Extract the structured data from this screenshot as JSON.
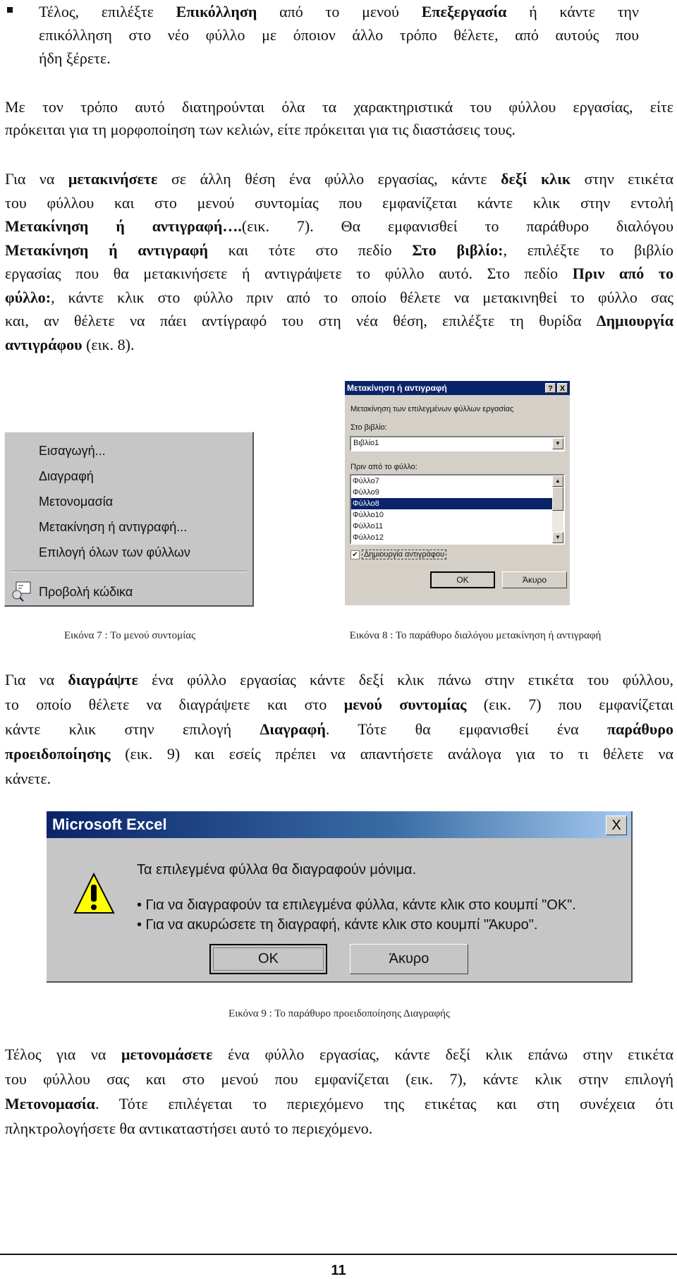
{
  "paragraphs": [
    {
      "id": "bullet-para",
      "lines": [
        [
          {
            "t": "Τέλος, επιλέξτε "
          },
          {
            "t": "Επικόλληση",
            "b": true
          },
          {
            "t": " από το μενού "
          },
          {
            "t": "Επεξεργασία",
            "b": true
          },
          {
            "t": " ή κάντε την"
          }
        ],
        [
          {
            "t": "επικόλληση στο νέο φύλλο με όποιον άλλο τρόπο θέλετε, από αυτούς που"
          }
        ],
        [
          {
            "t": "ήδη ξέρετε."
          }
        ]
      ]
    },
    {
      "id": "para-2",
      "lines": [
        [
          {
            "t": "Με τον τρόπο αυτό διατηρούνται όλα τα χαρακτηριστικά του φύλλου εργασίας, είτε"
          }
        ],
        [
          {
            "t": "πρόκειται για τη μορφοποίηση των κελιών, είτε πρόκειται για τις διαστάσεις τους."
          }
        ]
      ]
    },
    {
      "id": "para-3",
      "lines": [
        [
          {
            "t": "Για να "
          },
          {
            "t": "μετακινήσετε",
            "b": true
          },
          {
            "t": " σε άλλη θέση ένα φύλλο εργασίας, κάντε "
          },
          {
            "t": "δεξί κλικ",
            "b": true
          },
          {
            "t": " στην ετικέτα"
          }
        ],
        [
          {
            "t": "του φύλλου και στο μενού συντομίας που εμφανίζεται κάντε κλικ στην εντολή"
          }
        ],
        [
          {
            "t": "Μετακίνηση ή αντιγραφή….",
            "b": true
          },
          {
            "t": "(εικ. 7). Θα εμφανισθεί το παράθυρο διαλόγου"
          }
        ],
        [
          {
            "t": "Μετακίνηση ή αντιγραφή",
            "b": true
          },
          {
            "t": " και τότε στο πεδίο "
          },
          {
            "t": "Στο βιβλίο:",
            "b": true
          },
          {
            "t": ", επιλέξτε το βιβλίο"
          }
        ],
        [
          {
            "t": "εργασίας που θα μετακινήσετε ή αντιγράψετε το φύλλο αυτό. Στο πεδίο "
          },
          {
            "t": "Πριν από το",
            "b": true
          }
        ],
        [
          {
            "t": "φύλλο:",
            "b": true
          },
          {
            "t": ", κάντε κλικ στο φύλλο πριν από το οποίο θέλετε να μετακινηθεί το φύλλο σας"
          }
        ],
        [
          {
            "t": "και, αν θέλετε να πάει αντίγραφό του στη νέα θέση, επιλέξτε τη θυρίδα "
          },
          {
            "t": "Δημιουργία",
            "b": true
          }
        ],
        [
          {
            "t": "αντιγράφου",
            "b": true
          },
          {
            "t": " (εικ. 8)."
          }
        ]
      ]
    },
    {
      "id": "para-4",
      "lines": [
        [
          {
            "t": "Για να "
          },
          {
            "t": "διαγράψτε",
            "b": true
          },
          {
            "t": " ένα φύλλο εργασίας κάντε δεξί κλικ πάνω στην ετικέτα του φύλλου,"
          }
        ],
        [
          {
            "t": "το οποίο θέλετε να διαγράψετε και στο "
          },
          {
            "t": "μενού συντομίας",
            "b": true
          },
          {
            "t": " (εικ. 7) που εμφανίζεται"
          }
        ],
        [
          {
            "t": "κάντε κλικ στην επιλογή "
          },
          {
            "t": "Διαγραφή",
            "b": true
          },
          {
            "t": ". Τότε θα εμφανισθεί ένα "
          },
          {
            "t": "παράθυρο",
            "b": true
          }
        ],
        [
          {
            "t": "προειδοποίησης",
            "b": true
          },
          {
            "t": " (εικ. 9) και εσείς πρέπει να απαντήσετε ανάλογα για το τι θέλετε να"
          }
        ],
        [
          {
            "t": "κάνετε."
          }
        ]
      ]
    },
    {
      "id": "para-5",
      "lines": [
        [
          {
            "t": "Τέλος για να "
          },
          {
            "t": "μετονομάσετε",
            "b": true
          },
          {
            "t": " ένα φύλλο εργασίας, κάντε δεξί κλικ επάνω στην ετικέτα"
          }
        ],
        [
          {
            "t": "του φύλλου σας και στο μενού που εμφανίζεται (εικ. 7), κάντε κλικ στην επιλογή"
          }
        ],
        [
          {
            "t": "Μετονομασία",
            "b": true
          },
          {
            "t": ". Τότε επιλέγεται το περιεχόμενο της ετικέτας και στη συνέχεια ότι"
          }
        ],
        [
          {
            "t": "πληκτρολογήσετε θα αντικαταστήσει αυτό το περιεχόμενο."
          }
        ]
      ]
    }
  ],
  "context_menu": {
    "items": [
      "Εισαγωγή...",
      "Διαγραφή",
      "Μετονομασία",
      "Μετακίνηση ή αντιγραφή...",
      "Επιλογή όλων των φύλλων"
    ],
    "view_code": "Προβολή κώδικα",
    "view_code_icon": "view-code-icon"
  },
  "move_dialog": {
    "title": "Μετακίνηση ή αντιγραφή",
    "help": "?",
    "close": "X",
    "description": "Μετακίνηση των επιλεγμένων φύλλων εργασίας",
    "book_label": "Στο βιβλίο:",
    "book_value": "Βιβλίο1",
    "before_label": "Πριν από το φύλλο:",
    "sheets": [
      "Φύλλο7",
      "Φύλλο9",
      "Φύλλο8",
      "Φύλλο10",
      "Φύλλο11",
      "Φύλλο12"
    ],
    "selected_sheet": "Φύλλο8",
    "create_copy_label": "Δημιουργία αντιγράφου",
    "create_copy_checked": true,
    "ok": "OK",
    "cancel": "Άκυρο"
  },
  "excel_dialog": {
    "title": "Microsoft Excel",
    "close": "X",
    "message": "Τα επιλεγμένα φύλλα θα διαγραφούν μόνιμα.",
    "bullets": [
      "• Για να διαγραφούν τα επιλεγμένα φύλλα, κάντε κλικ στο κουμπί \"OK\".",
      "• Για να ακυρώσετε τη διαγραφή, κάντε κλικ στο κουμπί \"Άκυρο\"."
    ],
    "ok": "OK",
    "cancel": "Άκυρο",
    "icon": "warning-icon",
    "title_color": "#0a246a"
  },
  "captions": {
    "fig7": "Εικόνα 7 : Το μενού συντομίας",
    "fig8": "Εικόνα 8 : Το παράθυρο διαλόγου μετακίνηση ή αντιγραφή",
    "fig9": "Εικόνα 9 : Το παράθυρο προειδοποίησης Διαγραφής"
  },
  "page_number": "11"
}
